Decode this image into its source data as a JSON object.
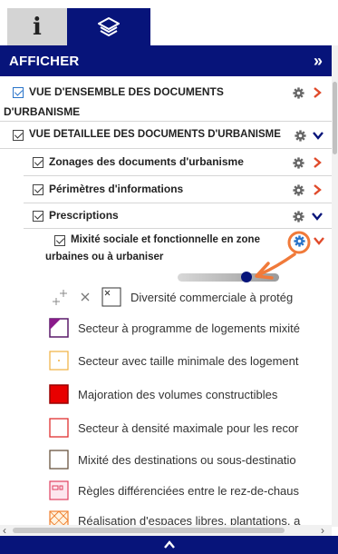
{
  "header": {
    "title": "AFFICHER",
    "collapse_label": "»"
  },
  "tabs": [
    {
      "label": "i"
    },
    {
      "label": ""
    }
  ],
  "tree": [
    {
      "label_line1": "VUE D'ENSEMBLE DES DOCUMENTS",
      "label_line2": "D'URBANISME"
    },
    {
      "label": "VUE DETAILLEE DES DOCUMENTS D'URBANISME"
    },
    {
      "label": "Zonages des documents d'urbanisme"
    },
    {
      "label": "Périmètres d'informations"
    },
    {
      "label": "Prescriptions"
    },
    {
      "label_line1": "Mixité sociale et fonctionnelle en zone",
      "label_line2": "urbaines ou à urbaniser"
    }
  ],
  "legend": [
    {
      "label": "Diversité commerciale à protég"
    },
    {
      "label": "Secteur à programme de logements mixité"
    },
    {
      "label": "Secteur avec taille minimale des logement"
    },
    {
      "label": "Majoration des volumes constructibles"
    },
    {
      "label": "Secteur à densité maximale pour les recor"
    },
    {
      "label": "Mixité des destinations ou sous-destinatio"
    },
    {
      "label": "Règles différenciées entre le rez-de-chaus"
    },
    {
      "label": "Réalisation d'espaces libres, plantations, a"
    }
  ],
  "slider": {
    "opacity_value": 0.7
  },
  "colors": {
    "brand": "#07147a",
    "chevron_open": "#07147a",
    "chevron_closed": "#e04a2a",
    "annotation": "#f07a3a"
  }
}
